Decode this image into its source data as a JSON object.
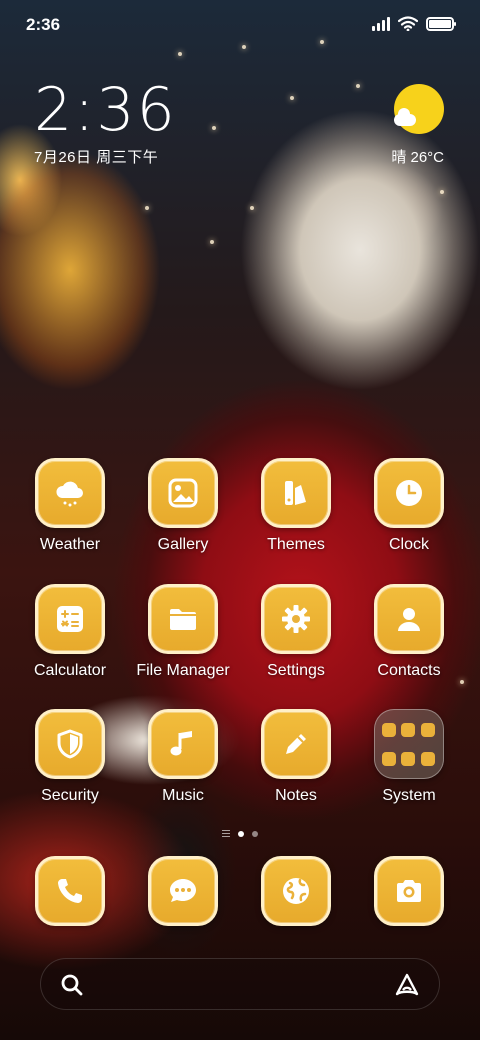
{
  "status": {
    "time": "2:36"
  },
  "clock": {
    "time": "2:36",
    "date": "7月26日 周三下午"
  },
  "weather": {
    "text": "晴 26°C"
  },
  "apps": [
    {
      "label": "Weather",
      "icon": "weather-icon"
    },
    {
      "label": "Gallery",
      "icon": "gallery-icon"
    },
    {
      "label": "Themes",
      "icon": "themes-icon"
    },
    {
      "label": "Clock",
      "icon": "clock-icon"
    },
    {
      "label": "Calculator",
      "icon": "calculator-icon"
    },
    {
      "label": "File Manager",
      "icon": "folder-icon"
    },
    {
      "label": "Settings",
      "icon": "gear-icon"
    },
    {
      "label": "Contacts",
      "icon": "contact-icon"
    },
    {
      "label": "Security",
      "icon": "shield-icon"
    },
    {
      "label": "Music",
      "icon": "music-note-icon"
    },
    {
      "label": "Notes",
      "icon": "pencil-icon"
    },
    {
      "label": "System",
      "icon": "folder-grid-icon"
    }
  ],
  "dock": [
    {
      "icon": "phone-icon"
    },
    {
      "icon": "message-icon"
    },
    {
      "icon": "browser-globe-icon"
    },
    {
      "icon": "camera-icon"
    }
  ],
  "colors": {
    "icon_fill": "#eab13a",
    "icon_border": "#fff0c8"
  }
}
